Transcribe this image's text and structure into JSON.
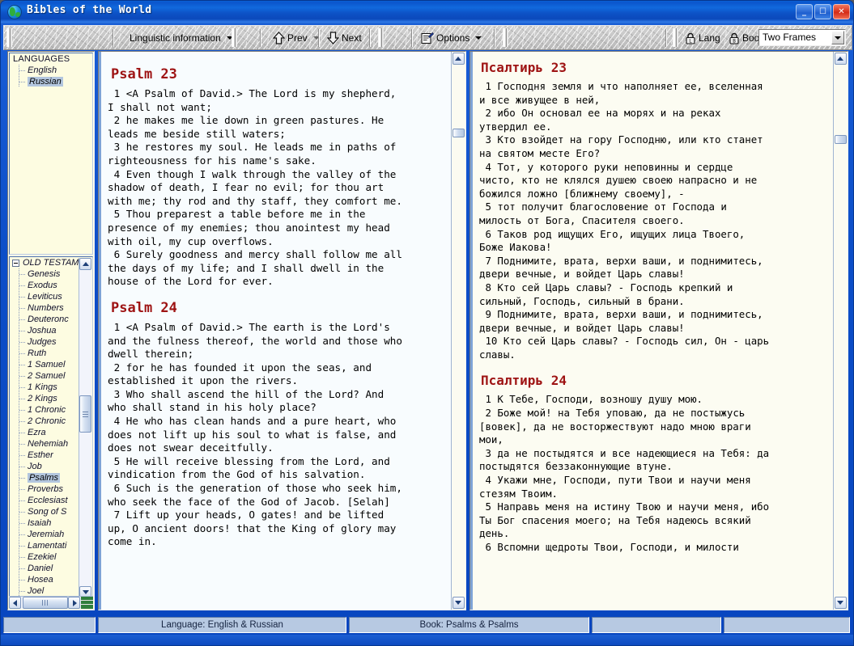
{
  "window": {
    "title": "Bibles of the World",
    "icon": "globe-icon",
    "minimize_label": "_",
    "maximize_label": "❐",
    "close_label": "✕"
  },
  "toolbar": {
    "linguistic_label": "Linguistic information",
    "prev_label": "Prev",
    "next_label": "Next",
    "options_label": "Options",
    "lang_label": "Lang",
    "book_label": "Book",
    "frames_value": "Two Frames",
    "frames_options": [
      "Two Frames"
    ]
  },
  "sidebar": {
    "languages_header": "LANGUAGES",
    "languages": [
      {
        "label": "English",
        "selected": false
      },
      {
        "label": "Russian",
        "selected": true
      }
    ],
    "books_root": "OLD TESTAM",
    "books": [
      {
        "label": "Genesis",
        "selected": false
      },
      {
        "label": "Exodus",
        "selected": false
      },
      {
        "label": "Leviticus",
        "selected": false
      },
      {
        "label": "Numbers",
        "selected": false
      },
      {
        "label": "Deuteronc",
        "selected": false
      },
      {
        "label": "Joshua",
        "selected": false
      },
      {
        "label": "Judges",
        "selected": false
      },
      {
        "label": "Ruth",
        "selected": false
      },
      {
        "label": "1 Samuel",
        "selected": false
      },
      {
        "label": "2 Samuel",
        "selected": false
      },
      {
        "label": "1 Kings",
        "selected": false
      },
      {
        "label": "2 Kings",
        "selected": false
      },
      {
        "label": "1 Chronic",
        "selected": false
      },
      {
        "label": "2 Chronic",
        "selected": false
      },
      {
        "label": "Ezra",
        "selected": false
      },
      {
        "label": "Nehemiah",
        "selected": false
      },
      {
        "label": "Esther",
        "selected": false
      },
      {
        "label": "Job",
        "selected": false
      },
      {
        "label": "Psalms",
        "selected": true
      },
      {
        "label": "Proverbs",
        "selected": false
      },
      {
        "label": "Ecclesiast",
        "selected": false
      },
      {
        "label": "Song of S",
        "selected": false
      },
      {
        "label": "Isaiah",
        "selected": false
      },
      {
        "label": "Jeremiah",
        "selected": false
      },
      {
        "label": "Lamentati",
        "selected": false
      },
      {
        "label": "Ezekiel",
        "selected": false
      },
      {
        "label": "Daniel",
        "selected": false
      },
      {
        "label": "Hosea",
        "selected": false
      },
      {
        "label": "Joel",
        "selected": false
      }
    ]
  },
  "left_pane": {
    "chapter1_title": "Psalm 23",
    "chapter1_text": " 1 <A Psalm of David.> The Lord is my shepherd,\nI shall not want;\n 2 he makes me lie down in green pastures. He\nleads me beside still waters;\n 3 he restores my soul. He leads me in paths of\nrighteousness for his name's sake.\n 4 Even though I walk through the valley of the\nshadow of death, I fear no evil; for thou art\nwith me; thy rod and thy staff, they comfort me.\n 5 Thou preparest a table before me in the\npresence of my enemies; thou anointest my head\nwith oil, my cup overflows.\n 6 Surely goodness and mercy shall follow me all\nthe days of my life; and I shall dwell in the\nhouse of the Lord for ever.",
    "chapter2_title": "Psalm 24",
    "chapter2_text": " 1 <A Psalm of David.> The earth is the Lord's\nand the fulness thereof, the world and those who\ndwell therein;\n 2 for he has founded it upon the seas, and\nestablished it upon the rivers.\n 3 Who shall ascend the hill of the Lord? And\nwho shall stand in his holy place?\n 4 He who has clean hands and a pure heart, who\ndoes not lift up his soul to what is false, and\ndoes not swear deceitfully.\n 5 He will receive blessing from the Lord, and\nvindication from the God of his salvation.\n 6 Such is the generation of those who seek him,\nwho seek the face of the God of Jacob. [Selah]\n 7 Lift up your heads, O gates! and be lifted\nup, O ancient doors! that the King of glory may\ncome in."
  },
  "right_pane": {
    "chapter1_title": "Псалтирь 23",
    "chapter1_text": " 1 Господня земля и что наполняет ее, вселенная\nи все живущее в ней,\n 2 ибо Он основал ее на морях и на реках\nутвердил ее.\n 3 Кто взойдет на гору Господню, или кто станет\nна святом месте Его?\n 4 Тот, у которого руки неповинны и сердце\nчисто, кто не клялся душею своею напрасно и не\nбожился ложно [ближнему своему], -\n 5 тот получит благословение от Господа и\nмилость от Бога, Спасителя своего.\n 6 Таков род ищущих Его, ищущих лица Твоего,\nБоже Иакова!\n 7 Поднимите, врата, верхи ваши, и поднимитесь,\nдвери вечные, и войдет Царь славы!\n 8 Кто сей Царь славы? - Господь крепкий и\nсильный, Господь, сильный в брани.\n 9 Поднимите, врата, верхи ваши, и поднимитесь,\nдвери вечные, и войдет Царь славы!\n 10 Кто сей Царь славы? - Господь сил, Он - царь\nславы.",
    "chapter2_title": "Псалтирь 24",
    "chapter2_text": " 1 К Тебе, Господи, возношу душу мою.\n 2 Боже мой! на Тебя уповаю, да не постыжусь\n[вовек], да не восторжествуют надо мною враги\nмои,\n 3 да не постыдятся и все надеющиеся на Тебя: да\nпостыдятся беззаконнующие втуне.\n 4 Укажи мне, Господи, пути Твои и научи меня\nстезям Твоим.\n 5 Направь меня на истину Твою и научи меня, ибо\nТы Бог спасения моего; на Тебя надеюсь всякий\nдень.\n 6 Вспомни щедроты Твои, Господи, и милости"
  },
  "statusbar": {
    "language": "Language:  English & Russian",
    "book": "Book:  Psalms & Psalms",
    "panel3": "",
    "panel4": "",
    "panel_left": ""
  },
  "colors": {
    "title_blue": "#0c4ec8",
    "chapter_red": "#9e1313",
    "tree_bg": "#fdfce1",
    "selection": "#b3c6de",
    "status_bg": "#b7c9e2"
  }
}
